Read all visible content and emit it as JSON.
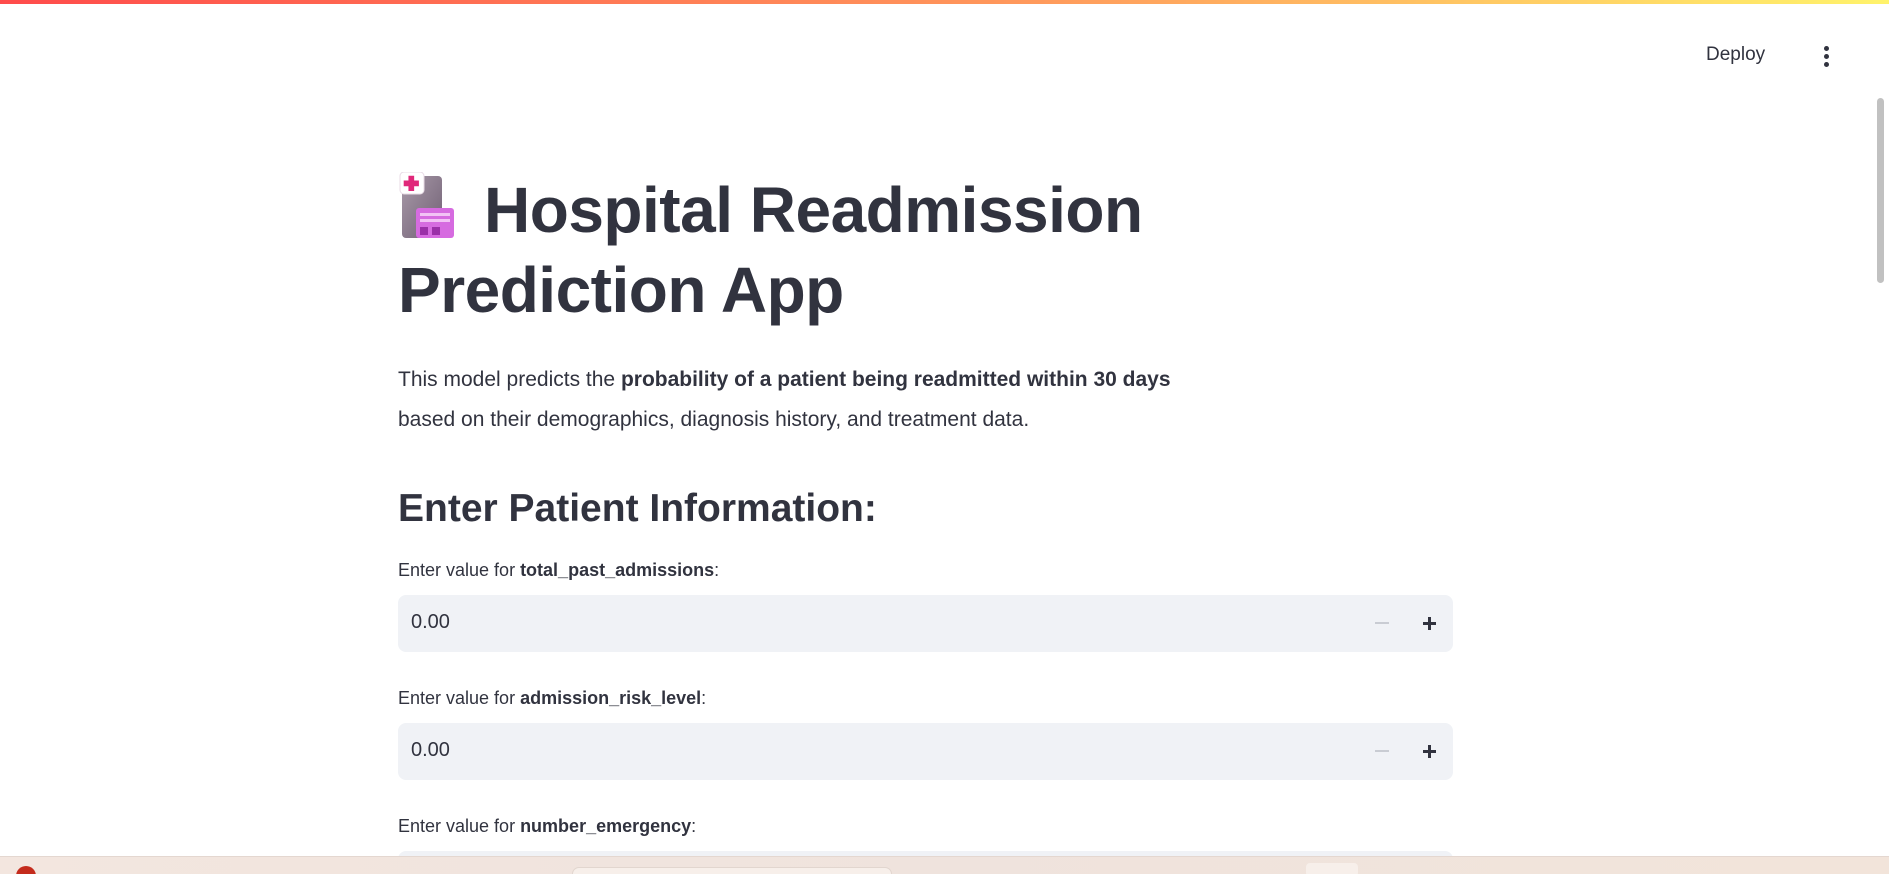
{
  "header": {
    "deploy_label": "Deploy",
    "menu_icon": "kebab-menu-icon"
  },
  "main": {
    "title_icon": "clipboard-medical-icon",
    "title": "Hospital Readmission Prediction App",
    "description": {
      "prefix": "This model predicts the ",
      "bold": "probability of a patient being readmitted within 30 days",
      "suffix": "based on their demographics, diagnosis history, and treatment data."
    },
    "section_heading": "Enter Patient Information:",
    "fields": [
      {
        "label_prefix": "Enter value for ",
        "name": "total_past_admissions",
        "label_suffix": ":",
        "value": "0.00"
      },
      {
        "label_prefix": "Enter value for ",
        "name": "admission_risk_level",
        "label_suffix": ":",
        "value": "0.00"
      },
      {
        "label_prefix": "Enter value for ",
        "name": "number_emergency",
        "label_suffix": ":",
        "value": ""
      }
    ]
  },
  "colors": {
    "input_background": "#f0f2f6",
    "text": "#31333f",
    "gradient": [
      "#ff4b4b",
      "#ff9a5c",
      "#fff36b"
    ]
  }
}
